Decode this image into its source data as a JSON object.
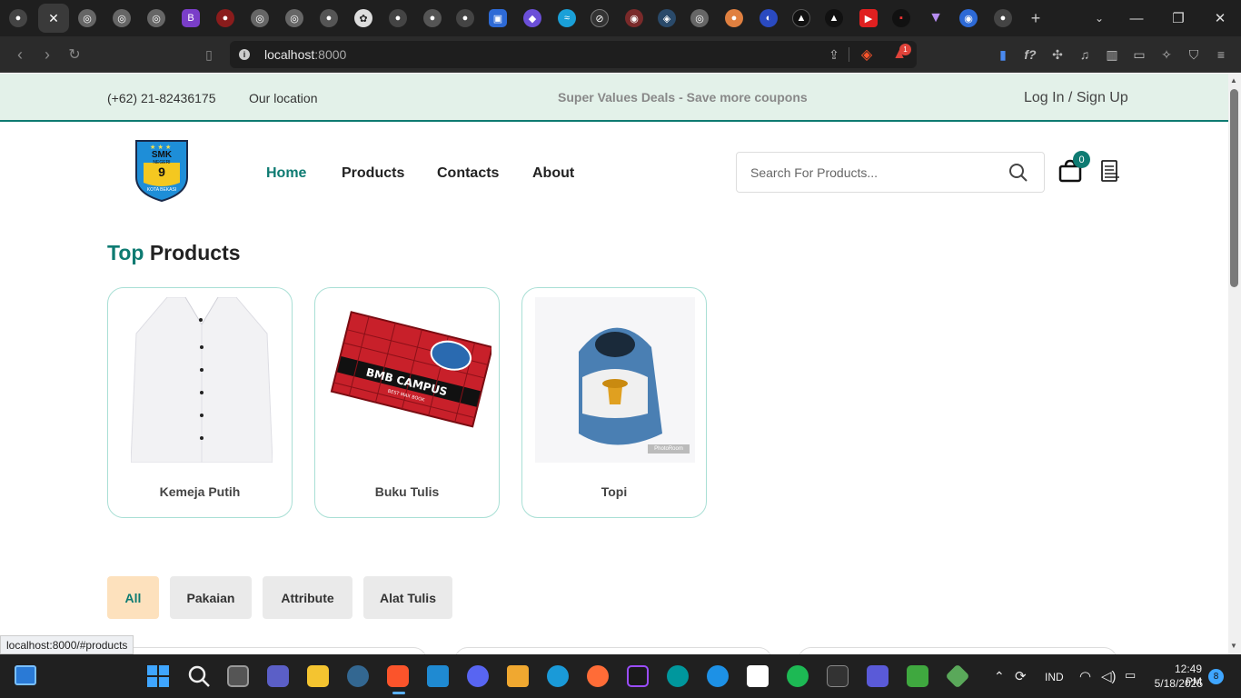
{
  "browser": {
    "url_host": "localhost",
    "url_port": ":8000",
    "shield_count": "1"
  },
  "topbar": {
    "phone": "(+62) 21-82436175",
    "location": "Our location",
    "promo": "Super Values Deals - Save more coupons",
    "auth": "Log In / Sign Up"
  },
  "logo": {
    "line1": "SMK",
    "line2": "NEGERI",
    "number": "9",
    "line3": "KOTA BEKASI"
  },
  "nav": {
    "home": "Home",
    "products": "Products",
    "contacts": "Contacts",
    "about": "About"
  },
  "search": {
    "placeholder": "Search For Products..."
  },
  "cart": {
    "count": "0"
  },
  "section": {
    "title_accent": "Top",
    "title_rest": " Products"
  },
  "products": [
    {
      "name": "Kemeja Putih"
    },
    {
      "name": "Buku Tulis"
    },
    {
      "name": "Topi"
    }
  ],
  "book_label": "BMB CAMPUS",
  "book_sub": "BEST MAX BOOK",
  "cap_watermark": "PhotoRoom",
  "filters": [
    "All",
    "Pakaian",
    "Attribute",
    "Alat Tulis"
  ],
  "statusbar": {
    "link": "localhost:8000/#products"
  },
  "taskbar": {
    "lang": "IND",
    "time": "12:49 PM",
    "date": "5/18/2025",
    "notifications": "8"
  },
  "colors": {
    "accent": "#0e7b72",
    "topbar_bg": "#e3f1e9",
    "active_filter": "#fde1bd"
  }
}
